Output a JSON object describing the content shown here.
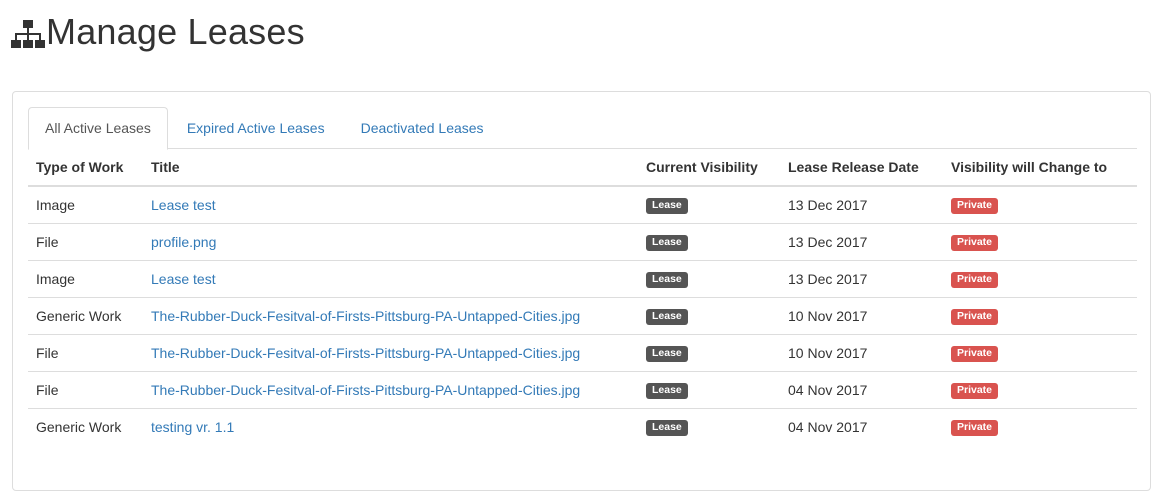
{
  "header": {
    "icon": "sitemap-icon",
    "title": "Manage Leases"
  },
  "tabs": [
    {
      "label": "All Active Leases",
      "active": true
    },
    {
      "label": "Expired Active Leases",
      "active": false
    },
    {
      "label": "Deactivated Leases",
      "active": false
    }
  ],
  "table": {
    "columns": [
      "Type of Work",
      "Title",
      "Current Visibility",
      "Lease Release Date",
      "Visibility will Change to"
    ],
    "rows": [
      {
        "type": "Image",
        "title": "Lease test",
        "visibility": "Lease",
        "date": "13 Dec 2017",
        "change_to": "Private"
      },
      {
        "type": "File",
        "title": "profile.png",
        "visibility": "Lease",
        "date": "13 Dec 2017",
        "change_to": "Private"
      },
      {
        "type": "Image",
        "title": "Lease test",
        "visibility": "Lease",
        "date": "13 Dec 2017",
        "change_to": "Private"
      },
      {
        "type": "Generic Work",
        "title": "The-Rubber-Duck-Fesitval-of-Firsts-Pittsburg-PA-Untapped-Cities.jpg",
        "visibility": "Lease",
        "date": "10 Nov 2017",
        "change_to": "Private"
      },
      {
        "type": "File",
        "title": "The-Rubber-Duck-Fesitval-of-Firsts-Pittsburg-PA-Untapped-Cities.jpg",
        "visibility": "Lease",
        "date": "10 Nov 2017",
        "change_to": "Private"
      },
      {
        "type": "File",
        "title": "The-Rubber-Duck-Fesitval-of-Firsts-Pittsburg-PA-Untapped-Cities.jpg",
        "visibility": "Lease",
        "date": "04 Nov 2017",
        "change_to": "Private"
      },
      {
        "type": "Generic Work",
        "title": "testing vr. 1.1",
        "visibility": "Lease",
        "date": "04 Nov 2017",
        "change_to": "Private"
      }
    ]
  },
  "colors": {
    "link": "#337ab7",
    "lease_badge": "#555555",
    "private_badge": "#d9534f"
  }
}
